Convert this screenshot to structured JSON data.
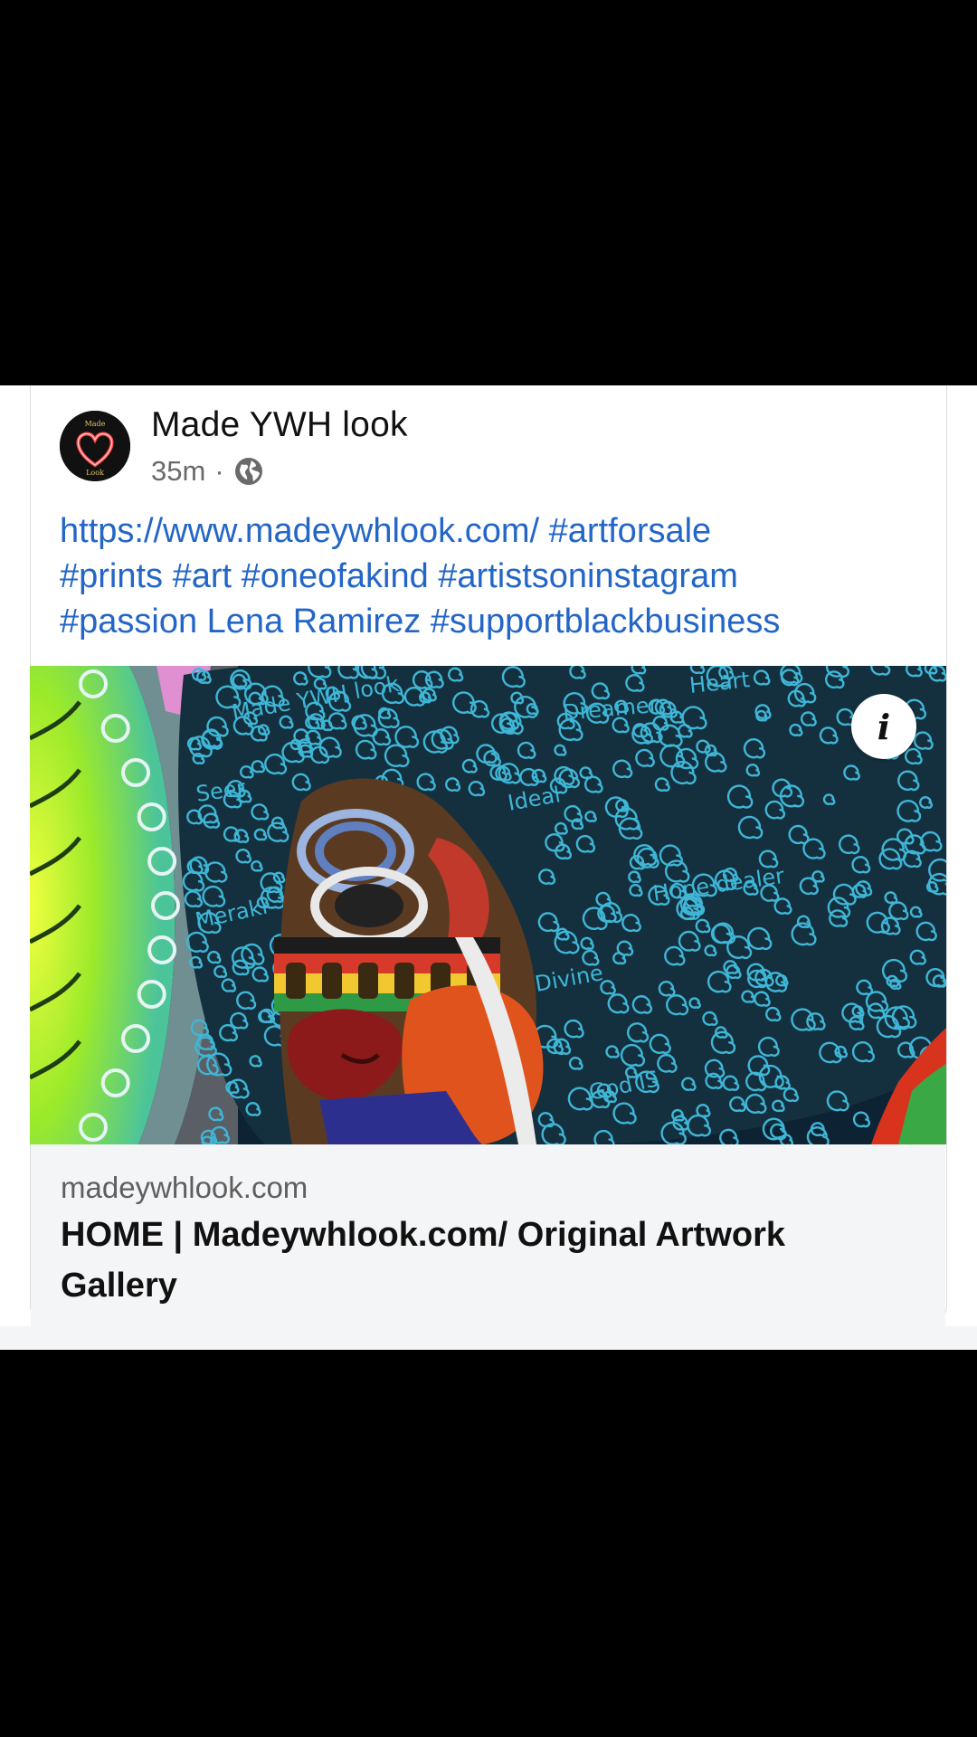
{
  "post": {
    "author": "Made YWH look",
    "time": "35m",
    "separator": "·",
    "privacy_icon": "globe-icon",
    "text_lines": [
      "https://www.madeywhlook.com/ #artforsale",
      "#prints #art #oneofakind #artistsoninstagram",
      "#passion Lena Ramirez #supportblackbusiness"
    ],
    "avatar_text_top": "Made",
    "avatar_text_bottom": "Look"
  },
  "link_preview": {
    "info_icon": "i",
    "domain": "madeywhlook.com",
    "title": "HOME | Madeywhlook.com/ Original Artwork Gallery",
    "artwork_words": [
      "Made YWH look",
      "Dreamer",
      "Heart",
      "Seer",
      "Meraki",
      "Hope dealer",
      "Divine",
      "God IS",
      "Ideal"
    ]
  },
  "colors": {
    "link_blue": "#2366c7",
    "swirl_blue": "#3fb6d6",
    "background": "#000000"
  }
}
